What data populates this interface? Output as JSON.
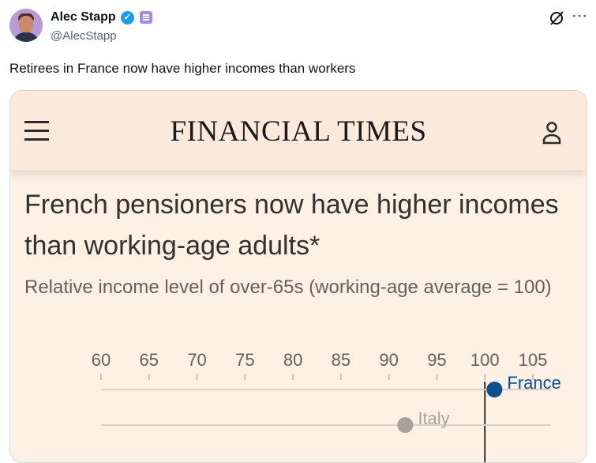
{
  "tweet": {
    "author_name": "Alec Stapp",
    "verified_mark": "✓",
    "handle": "@AlecStapp",
    "more_label": "···",
    "text": "Retirees in France now have higher incomes than workers"
  },
  "ft": {
    "logo": "FINANCIAL TIMES",
    "headline": "French pensioners now have higher incomes than working-age adults*",
    "subtitle": "Relative income level of over-65s (working-age average = 100)"
  },
  "colors": {
    "brand_bg": "#fbeadc",
    "card_bg": "#fdf1e6",
    "france": "#0d4f8b",
    "other": "#a8a29c",
    "verified": "#1d9bf0"
  },
  "chart_data": {
    "type": "scatter",
    "x_ticks": [
      60,
      65,
      70,
      75,
      80,
      85,
      90,
      95,
      100,
      105
    ],
    "xlim": [
      60,
      105
    ],
    "reference_line": 100,
    "series": [
      {
        "name": "France",
        "value": 101
      },
      {
        "name": "Italy",
        "value": 91.7
      }
    ]
  }
}
